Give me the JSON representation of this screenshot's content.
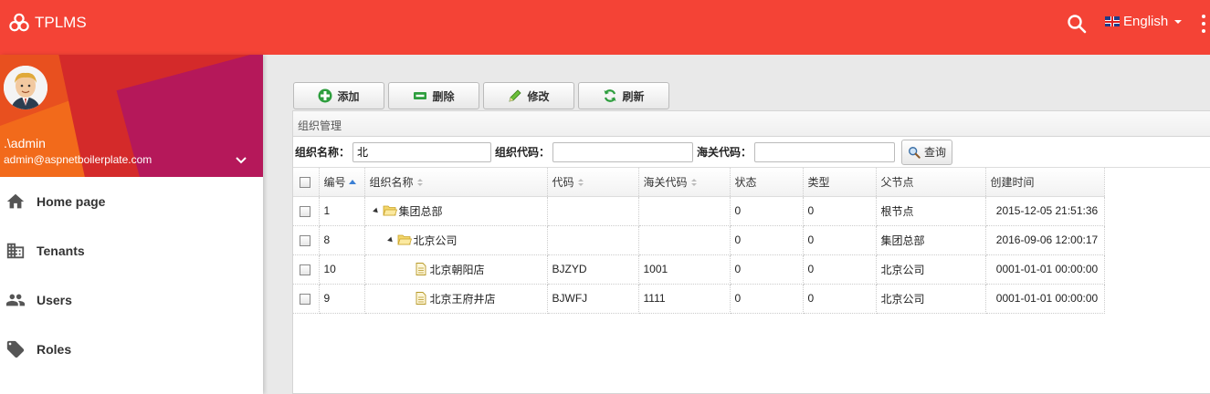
{
  "app": {
    "title": "TPLMS"
  },
  "header": {
    "language": "English"
  },
  "user": {
    "name": ".\\admin",
    "email": "admin@aspnetboilerplate.com"
  },
  "sidebar": {
    "items": [
      {
        "label": "Home page",
        "icon": "home-icon"
      },
      {
        "label": "Tenants",
        "icon": "business-icon"
      },
      {
        "label": "Users",
        "icon": "people-icon"
      },
      {
        "label": "Roles",
        "icon": "tag-icon"
      }
    ]
  },
  "toolbar": {
    "add_label": "添加",
    "delete_label": "删除",
    "edit_label": "修改",
    "refresh_label": "刷新"
  },
  "panel": {
    "title": "组织管理"
  },
  "search": {
    "org_name_label": "组织名称：",
    "org_name_value": "北",
    "org_code_label": "组织代码：",
    "org_code_value": "",
    "customs_code_label": "海关代码：",
    "customs_code_value": "",
    "query_label": "查询"
  },
  "table": {
    "columns": [
      "编号",
      "组织名称",
      "代码",
      "海关代码",
      "状态",
      "类型",
      "父节点",
      "创建时间"
    ],
    "rows": [
      {
        "id": "1",
        "name": "集团总部",
        "code": "",
        "customs": "",
        "status": "0",
        "type": "0",
        "parent": "根节点",
        "created": "2015-12-05 21:51:36"
      },
      {
        "id": "8",
        "name": "北京公司",
        "code": "",
        "customs": "",
        "status": "0",
        "type": "0",
        "parent": "集团总部",
        "created": "2016-09-06 12:00:17"
      },
      {
        "id": "10",
        "name": "北京朝阳店",
        "code": "BJZYD",
        "customs": "1001",
        "status": "0",
        "type": "0",
        "parent": "北京公司",
        "created": "0001-01-01 00:00:00"
      },
      {
        "id": "9",
        "name": "北京王府井店",
        "code": "BJWFJ",
        "customs": "1111",
        "status": "0",
        "type": "0",
        "parent": "北京公司",
        "created": "0001-01-01 00:00:00"
      }
    ]
  },
  "colors": {
    "primary": "#f44336",
    "sidebar_bg": "#ffffff",
    "content_bg": "#e9e9e9"
  }
}
